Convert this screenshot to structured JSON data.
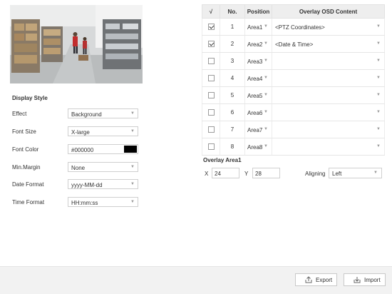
{
  "display_style": {
    "title": "Display Style",
    "effect": {
      "label": "Effect",
      "value": "Background"
    },
    "font_size": {
      "label": "Font Size",
      "value": "X-large"
    },
    "font_color": {
      "label": "Font Color",
      "value": "#000000",
      "swatch_color": "#000000"
    },
    "min_margin": {
      "label": "Min.Margin",
      "value": "None"
    },
    "date_format": {
      "label": "Date Format",
      "value": "yyyy-MM-dd"
    },
    "time_format": {
      "label": "Time Format",
      "value": "HH:mm:ss"
    }
  },
  "osd_table": {
    "headers": {
      "check": "√",
      "no": "No.",
      "position": "Position",
      "content": "Overlay OSD Content"
    },
    "rows": [
      {
        "checked": true,
        "no": "1",
        "position": "Area1",
        "content": "<PTZ Coordinates>"
      },
      {
        "checked": true,
        "no": "2",
        "position": "Area2",
        "content": "<Date & Time>"
      },
      {
        "checked": false,
        "no": "3",
        "position": "Area3",
        "content": ""
      },
      {
        "checked": false,
        "no": "4",
        "position": "Area4",
        "content": ""
      },
      {
        "checked": false,
        "no": "5",
        "position": "Area5",
        "content": ""
      },
      {
        "checked": false,
        "no": "6",
        "position": "Area6",
        "content": ""
      },
      {
        "checked": false,
        "no": "7",
        "position": "Area7",
        "content": ""
      },
      {
        "checked": false,
        "no": "8",
        "position": "Area8",
        "content": ""
      }
    ]
  },
  "overlay_area": {
    "title": "Overlay Area1",
    "x_label": "X",
    "x_value": "24",
    "y_label": "Y",
    "y_value": "28",
    "aligning_label": "Aligning",
    "aligning_value": "Left"
  },
  "footer": {
    "export_label": "Export",
    "import_label": "Import"
  }
}
